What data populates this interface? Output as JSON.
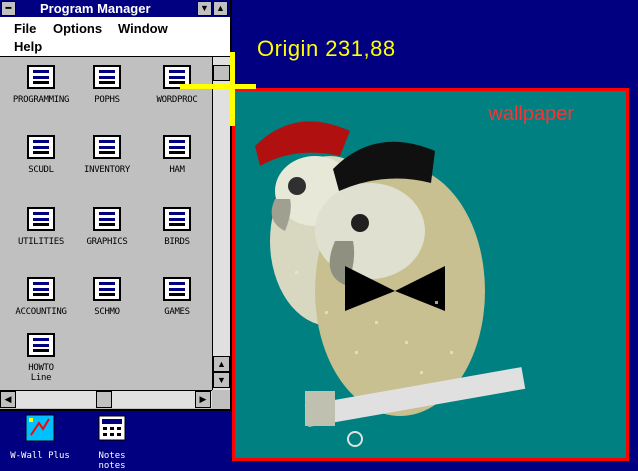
{
  "desktop": {
    "origin_label": "Origin 231,88",
    "wallpaper_label": "wallpaper",
    "icons": [
      {
        "label": "W-Wall Plus",
        "icon": "wallpaper-app-icon"
      },
      {
        "label": "Notes\nnotes",
        "icon": "calculator-app-icon"
      }
    ]
  },
  "program_manager": {
    "title": "Program Manager",
    "menu": {
      "file": "File",
      "options": "Options",
      "window": "Window",
      "help": "Help"
    },
    "groups": [
      {
        "label": "PROGRAMMING"
      },
      {
        "label": "POPHS"
      },
      {
        "label": "WORDPROC"
      },
      {
        "label": "SCUDL"
      },
      {
        "label": "INVENTORY"
      },
      {
        "label": "HAM"
      },
      {
        "label": "UTILITIES"
      },
      {
        "label": "GRAPHICS"
      },
      {
        "label": "BIRDS"
      },
      {
        "label": "ACCOUNTING"
      },
      {
        "label": "SCHMO"
      },
      {
        "label": "GAMES"
      },
      {
        "label": "HOWTO\nLine"
      }
    ]
  },
  "colors": {
    "desktop": "#000080",
    "wallpaper_bg": "#008080",
    "wallpaper_border": "#ff0000",
    "crosshair": "#ffff00",
    "window_bg": "#c0c0c0"
  }
}
